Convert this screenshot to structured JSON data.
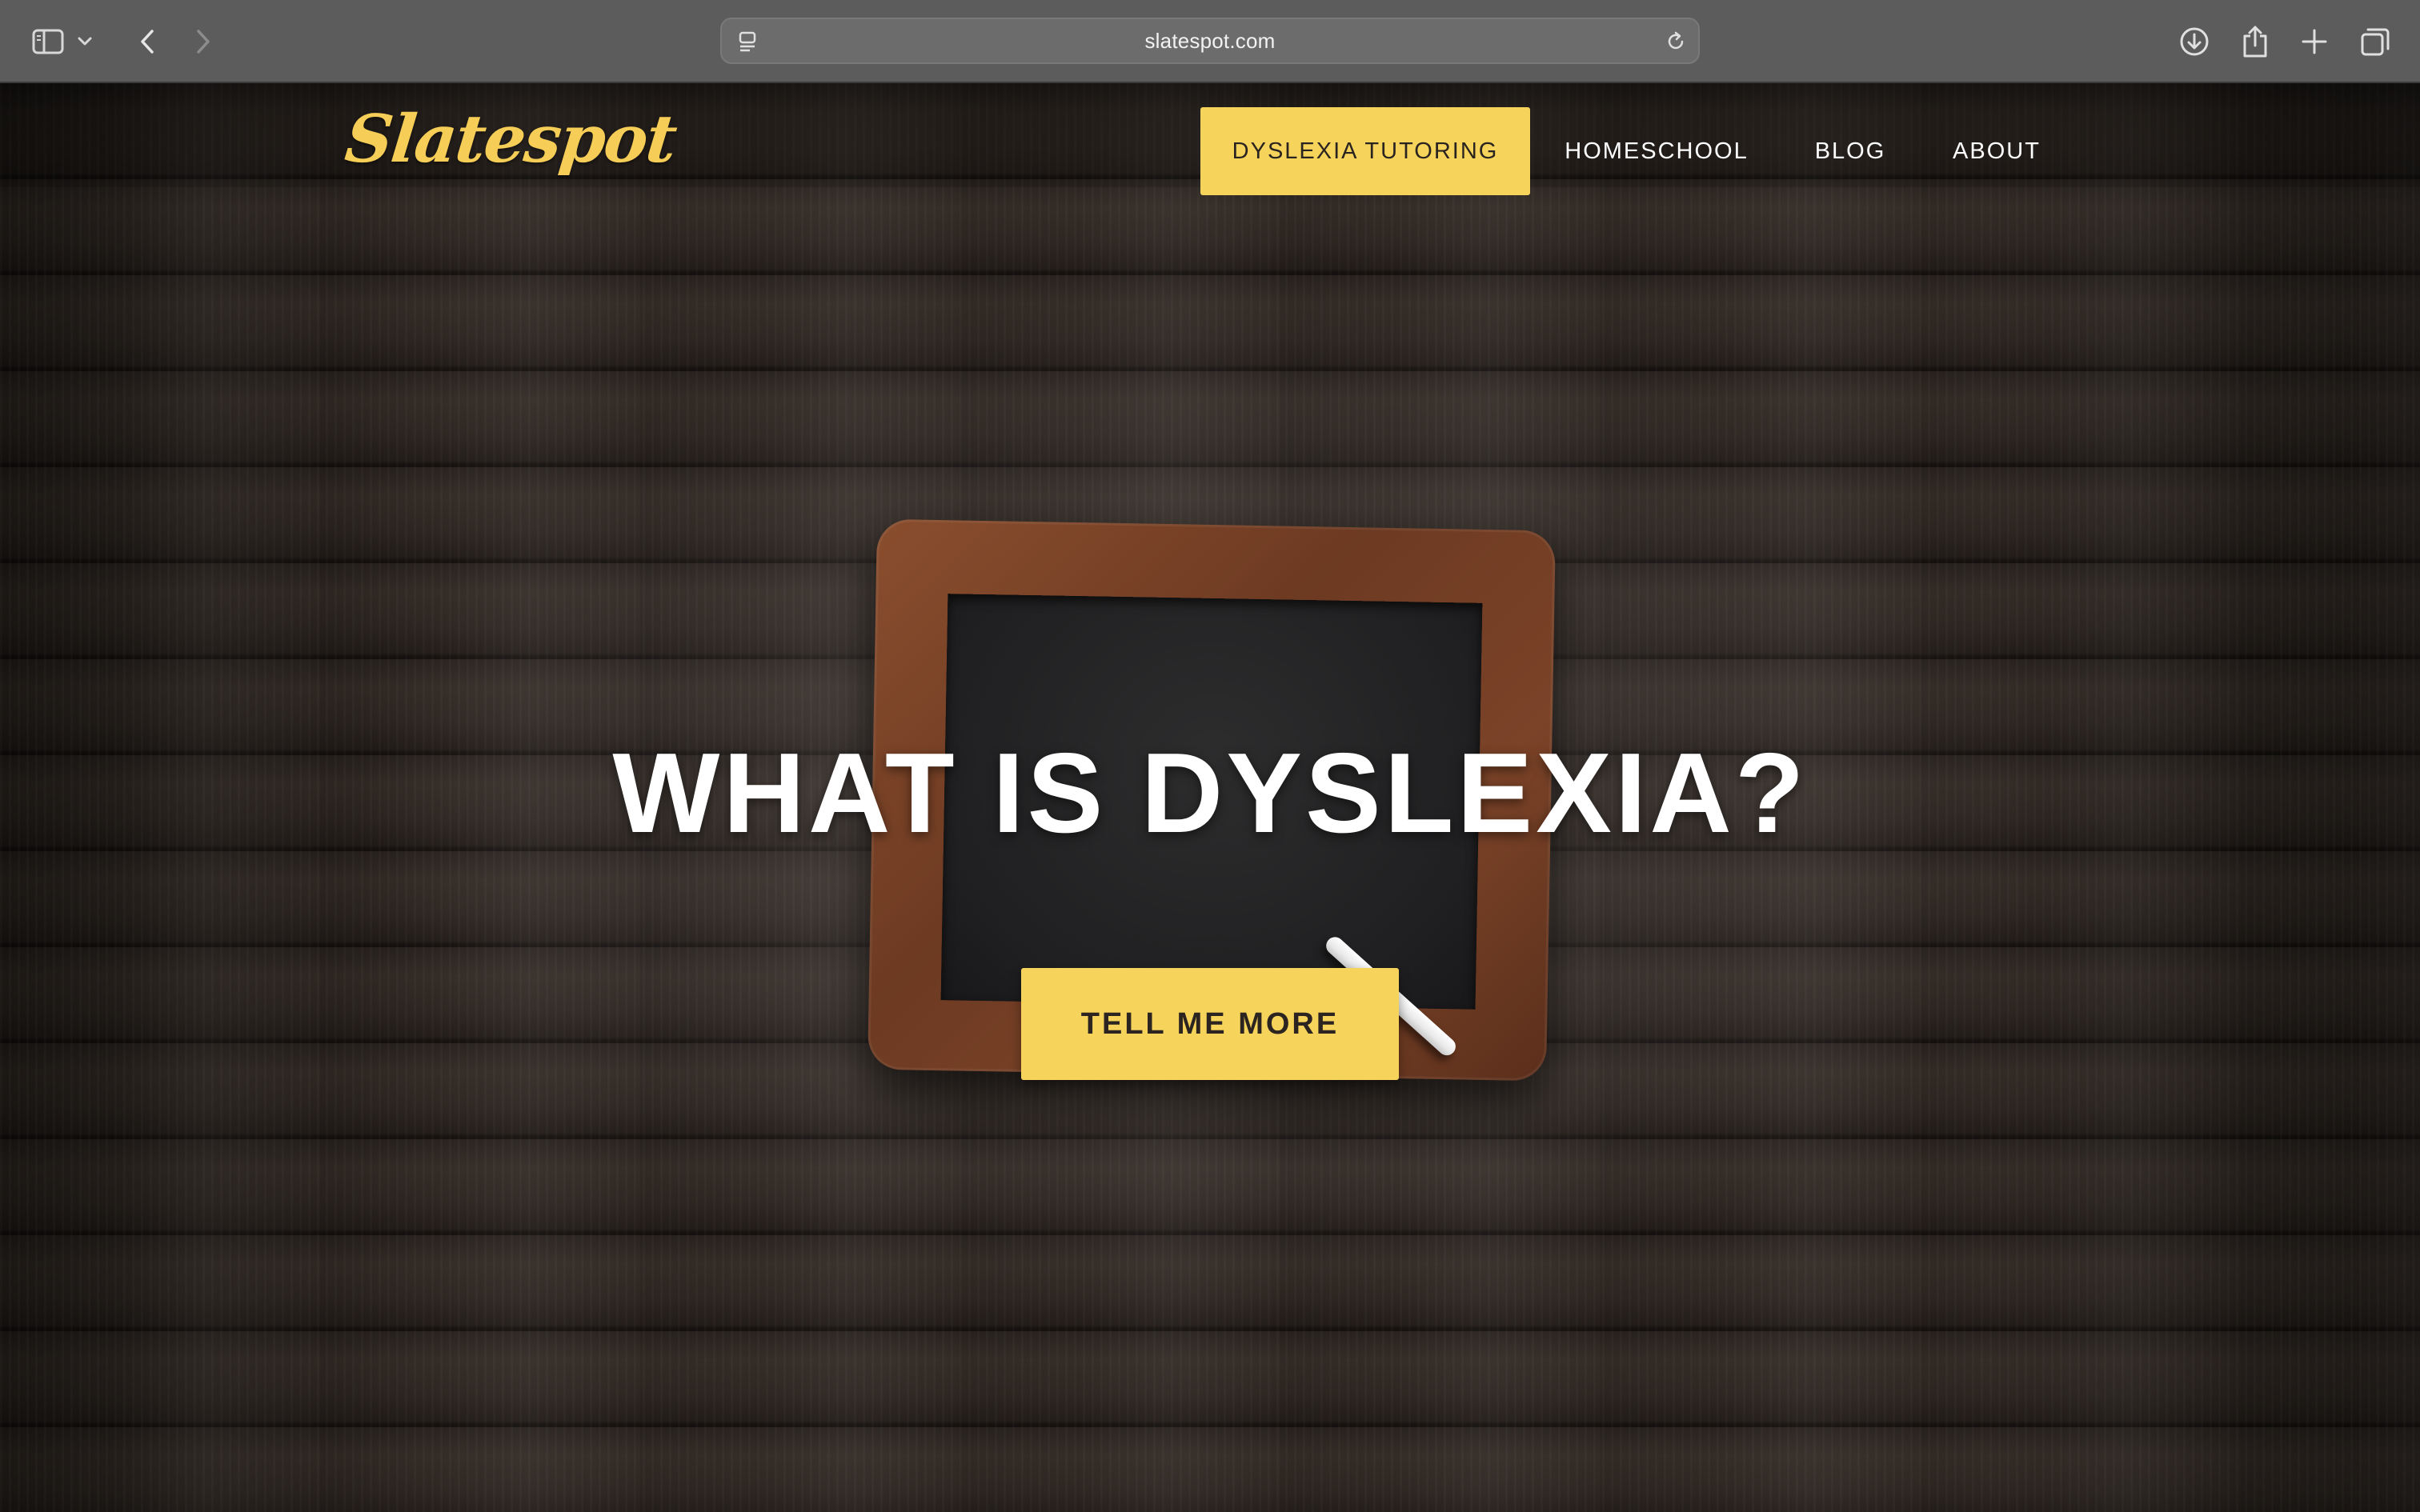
{
  "browser": {
    "url": "slatespot.com",
    "icons": {
      "sidebar": "sidebar-icon",
      "tab_menu": "chevron-down-icon",
      "back": "chevron-left-icon",
      "forward": "chevron-right-icon",
      "page_menu": "page-menu-icon",
      "reload": "reload-icon",
      "download": "download-icon",
      "share": "share-icon",
      "new_tab": "plus-icon",
      "tab_overview": "tabs-icon"
    }
  },
  "site": {
    "logo": "Slatespot",
    "nav": [
      {
        "label": "DYSLEXIA TUTORING",
        "active": true
      },
      {
        "label": "HOMESCHOOL",
        "active": false
      },
      {
        "label": "BLOG",
        "active": false
      },
      {
        "label": "ABOUT",
        "active": false
      }
    ]
  },
  "hero": {
    "title": "WHAT IS DYSLEXIA?",
    "cta_label": "TELL ME MORE"
  },
  "colors": {
    "accent": "#f6d35a",
    "logo": "#f5cd57",
    "toolbar": "#5d5c5d",
    "wood_dark": "#2a2420",
    "frame": "#7b4328"
  }
}
